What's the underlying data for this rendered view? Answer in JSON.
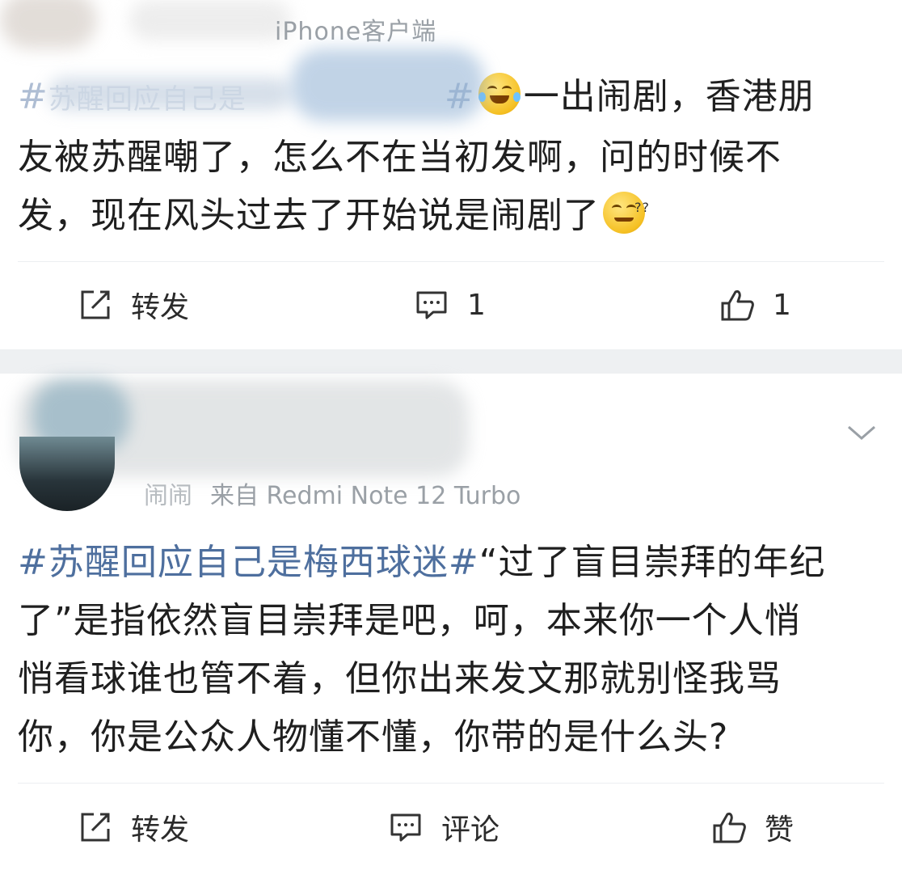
{
  "post1": {
    "source": "iPhone客户端",
    "topic_prefix": "#",
    "topic_blurred": "苏醒回应自己是",
    "topic_suffix": "#",
    "text_line1": "一出闹剧，香港朋",
    "text_line2": "友被苏醒嘲了，怎么不在当初发啊，问的时候不",
    "text_line3": "发，现在风头过去了开始说是闹剧了",
    "emoji1": "laugh-cry-emoji",
    "emoji2": "confused-emoji",
    "repost_label": "转发",
    "comment_count": "1",
    "like_count": "1"
  },
  "post2": {
    "user_name": "闹闹",
    "source": "来自 Redmi Note 12 Turbo",
    "topic": "#苏醒回应自己是梅西球迷#",
    "text_line1": "“过了盲目崇拜的年纪",
    "text_line2": "了”是指依然盲目崇拜是吧，呵，本来你一个人悄",
    "text_line3": "悄看球谁也管不着，但你出来发文那就别怪我骂",
    "text_line4": "你，你是公众人物懂不懂，你带的是什么头?",
    "repost_label": "转发",
    "comment_label": "评论",
    "like_label": "赞"
  },
  "colors": {
    "topic_link": "#4e6f9e",
    "text": "#1f1f1f",
    "meta": "#9aa0a6",
    "separator": "#eef0f2"
  }
}
